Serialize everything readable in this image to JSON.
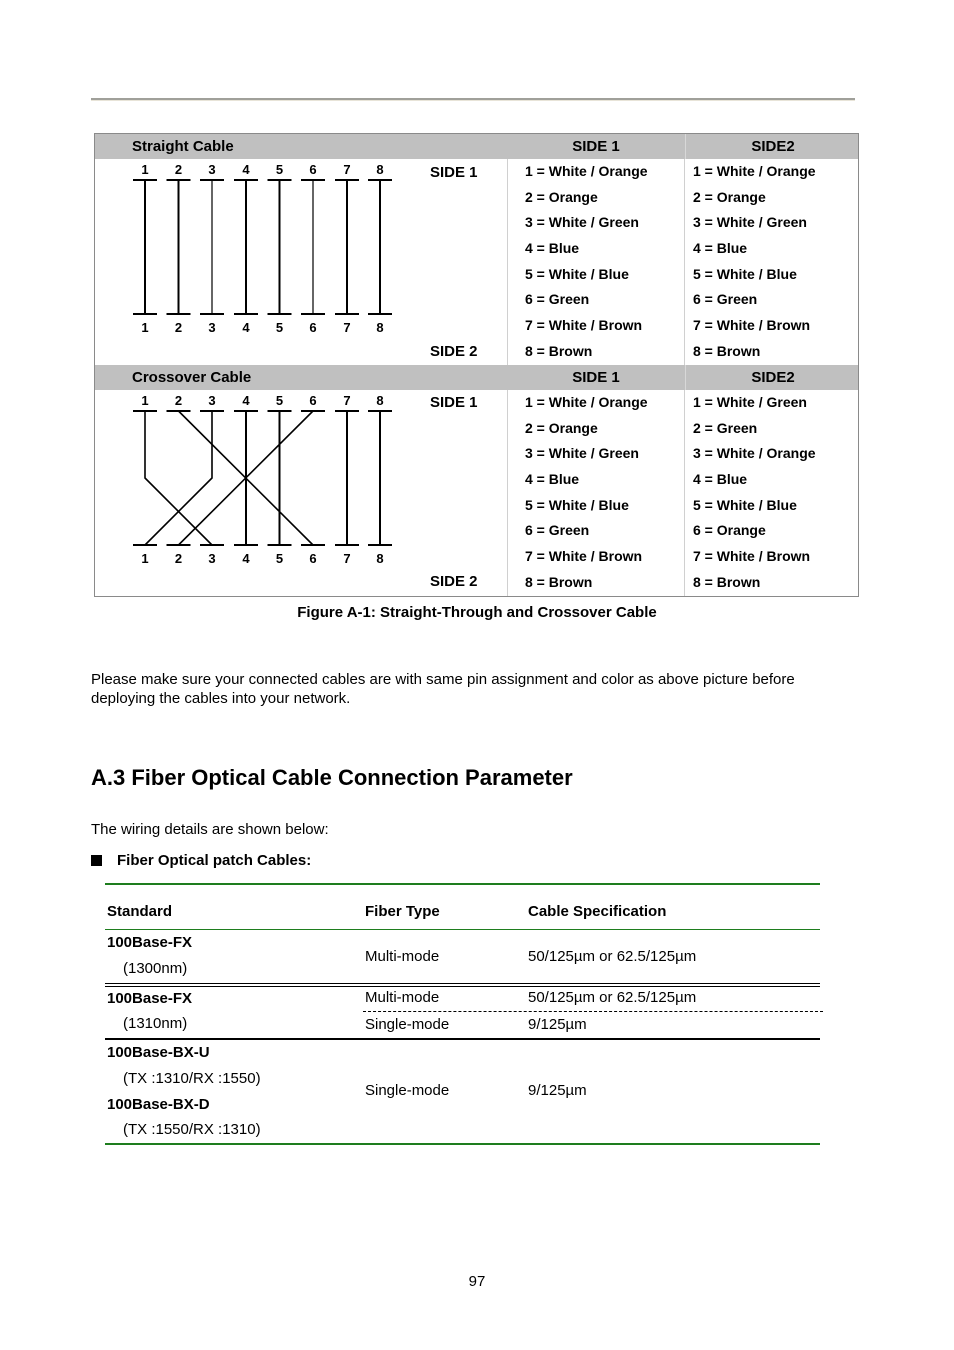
{
  "figure": {
    "straight": {
      "title": "Straight Cable",
      "side1_header": "SIDE 1",
      "side2_header": "SIDE2",
      "side1_label": "SIDE 1",
      "side2_label": "SIDE 2",
      "pins_top": [
        "1",
        "2",
        "3",
        "4",
        "5",
        "6",
        "7",
        "8"
      ],
      "pins_bottom": [
        "1",
        "2",
        "3",
        "4",
        "5",
        "6",
        "7",
        "8"
      ],
      "wiring": [
        1,
        2,
        3,
        4,
        5,
        6,
        7,
        8
      ],
      "side1": [
        "1 = White / Orange",
        "2 = Orange",
        "3 = White / Green",
        "4 = Blue",
        "5 = White / Blue",
        "6 = Green",
        "7 = White / Brown",
        "8 = Brown"
      ],
      "side2": [
        "1 = White / Orange",
        "2 = Orange",
        "3 = White / Green",
        "4 = Blue",
        "5 = White / Blue",
        "6 = Green",
        "7 = White / Brown",
        "8 = Brown"
      ]
    },
    "crossover": {
      "title": "Crossover Cable",
      "side1_header": "SIDE 1",
      "side2_header": "SIDE2",
      "side1_label": "SIDE 1",
      "side2_label": "SIDE 2",
      "pins_top": [
        "1",
        "2",
        "3",
        "4",
        "5",
        "6",
        "7",
        "8"
      ],
      "pins_bottom": [
        "1",
        "2",
        "3",
        "4",
        "5",
        "6",
        "7",
        "8"
      ],
      "wiring": [
        3,
        6,
        1,
        4,
        5,
        2,
        7,
        8
      ],
      "side1": [
        "1 = White / Orange",
        "2 = Orange",
        "3 = White / Green",
        "4 = Blue",
        "5 = White / Blue",
        "6 = Green",
        "7 = White / Brown",
        "8 = Brown"
      ],
      "side2": [
        "1 = White / Green",
        "2 = Green",
        "3 = White / Orange",
        "4 = Blue",
        "5 = White / Blue",
        "6 = Orange",
        "7 = White / Brown",
        "8 = Brown"
      ]
    },
    "caption": "Figure A-1: Straight-Through and Crossover Cable"
  },
  "paragraph": "Please make sure your connected cables are with same pin assignment and color as above picture before deploying the cables into your network.",
  "section": {
    "heading": "A.3 Fiber Optical Cable Connection Parameter",
    "intro": "The wiring details are shown below:",
    "bullet": "Fiber Optical patch Cables:"
  },
  "fiber_table": {
    "headers": [
      "Standard",
      "Fiber Type",
      "Cable Specification"
    ],
    "rows": [
      {
        "standard": "100Base-FX",
        "sub": "(1300nm)",
        "type": "Multi-mode",
        "spec": "50/125µm or 62.5/125µm"
      },
      {
        "standard": "100Base-FX",
        "sub": "(1310nm)",
        "type_a": "Multi-mode",
        "spec_a": "50/125µm or 62.5/125µm",
        "type_b": "Single-mode",
        "spec_b": "9/125µm"
      },
      {
        "standard_u": "100Base-BX-U",
        "sub_u": "(TX :1310/RX :1550)",
        "standard_d": "100Base-BX-D",
        "sub_d": "(TX :1550/RX :1310)",
        "type": "Single-mode",
        "spec": "9/125µm"
      }
    ]
  },
  "page_number": "97"
}
